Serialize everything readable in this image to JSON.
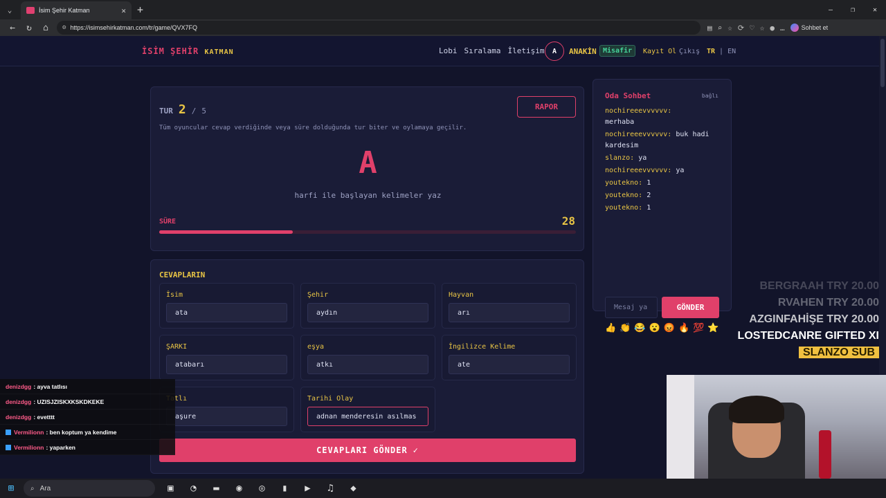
{
  "browser": {
    "tab_title": "İsim Şehir Katman",
    "url": "https://isimsehirkatman.com/tr/game/QVX7FQ",
    "copilot_label": "Sohbet et"
  },
  "nav": {
    "logo_part1": "İSİM ŞEHİR",
    "logo_part2": "KATMAN",
    "links": [
      "Lobi",
      "Sıralama",
      "İletişim"
    ],
    "avatar_letter": "A",
    "username": "ANAKİN",
    "guest_badge": "Misafir",
    "register": "Kayıt Ol",
    "logout": "Çıkış",
    "lang_active": "TR",
    "lang_sep": "|",
    "lang_other": "EN"
  },
  "round": {
    "label": "TUR",
    "current": "2",
    "sep": "/",
    "total": "5",
    "report_button": "RAPOR",
    "hint": "Tüm oyuncular cevap verdiğinde veya süre dolduğunda tur biter ve oylamaya geçilir.",
    "letter": "A",
    "letter_caption": "harfi ile başlayan kelimeler yaz",
    "timer_label": "SÜRE",
    "timer_value": "28",
    "timer_progress_fraction": 0.32
  },
  "answers": {
    "title": "CEVAPLARIN",
    "fields": [
      {
        "label": "İsim",
        "value": "ata"
      },
      {
        "label": "Şehir",
        "value": "aydın"
      },
      {
        "label": "Hayvan",
        "value": "arı"
      },
      {
        "label": "ŞARKI",
        "value": "atabarı"
      },
      {
        "label": "eşya",
        "value": "atkı"
      },
      {
        "label": "İngilizce Kelime",
        "value": "ate"
      },
      {
        "label": "Tatlı",
        "value": "aşure"
      },
      {
        "label": "Tarihi Olay",
        "value": "adnan menderesin asılmas"
      }
    ],
    "submit_label": "CEVAPLARI GÖNDER",
    "submit_icon": "✓"
  },
  "chat": {
    "title": "Oda Sohbet",
    "status": "bağlı",
    "messages": [
      {
        "user": "nochireeevvvvvv:",
        "text": "merhaba"
      },
      {
        "user": "nochireeevvvvvv:",
        "text": "buk hadi kardesim"
      },
      {
        "user": "slanzo:",
        "text": "ya"
      },
      {
        "user": "nochireeevvvvvv:",
        "text": "ya"
      },
      {
        "user": "youtekno:",
        "text": "1"
      },
      {
        "user": "youtekno:",
        "text": "2"
      },
      {
        "user": "youtekno:",
        "text": "1"
      }
    ],
    "input_placeholder": "Mesaj ya",
    "send_label": "GÖNDER",
    "emojis": [
      "👍",
      "👏",
      "😂",
      "😮",
      "😡",
      "🔥",
      "💯",
      "⭐"
    ]
  },
  "overlay": {
    "donors": [
      "BERGRAAH  TRY 20.00",
      "RVAHEN  TRY 20.00",
      "AZGINFAHİŞE  TRY 20.00",
      "LOSTEDCANRE  GIFTED XI",
      "SLANZO  SUB"
    ],
    "stream_chat": [
      {
        "user": "denizdgg",
        "text": ": ayva tatlısı"
      },
      {
        "user": "denizdgg",
        "text": ": UZISJZISKXKSKDKEKE"
      },
      {
        "user": "denizdgg",
        "text": ": evetttt"
      },
      {
        "user": "Vermilionn",
        "text": ": ben koptum ya kendime"
      },
      {
        "user": "Vermilionn",
        "text": ": yaparken"
      }
    ]
  },
  "taskbar": {
    "search_placeholder": "Ara"
  }
}
